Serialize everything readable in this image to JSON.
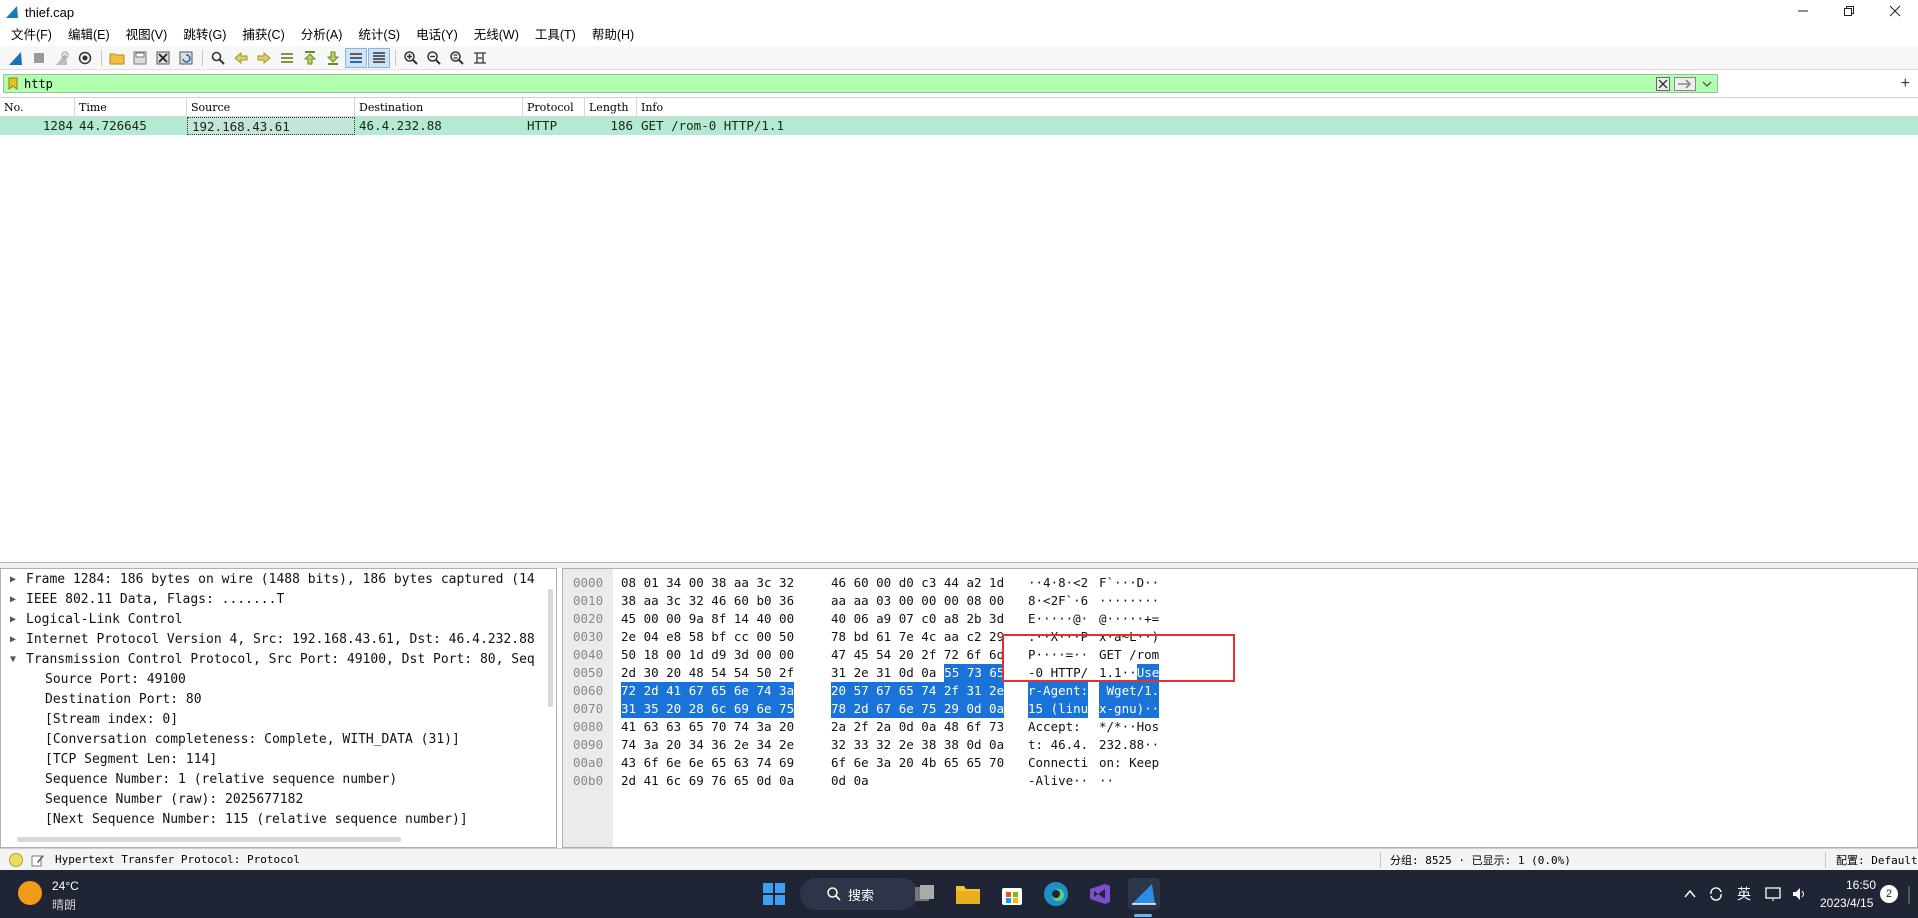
{
  "window": {
    "title": "thief.cap"
  },
  "menu": [
    "文件(F)",
    "编辑(E)",
    "视图(V)",
    "跳转(G)",
    "捕获(C)",
    "分析(A)",
    "统计(S)",
    "电话(Y)",
    "无线(W)",
    "工具(T)",
    "帮助(H)"
  ],
  "toolbar_icons": [
    "shark-fin-start-icon",
    "stop-icon",
    "restart-icon",
    "options-gear-icon",
    "open-folder-icon",
    "save-file-icon",
    "close-file-icon",
    "reload-icon",
    "find-icon",
    "back-icon",
    "forward-icon",
    "goto-packet-icon",
    "first-packet-icon",
    "last-packet-icon",
    "autoscroll-icon",
    "colorize-icon",
    "zoom-in-icon",
    "zoom-out-icon",
    "normal-size-icon",
    "resize-columns-icon"
  ],
  "filter": {
    "value": "http"
  },
  "packet_list": {
    "columns": [
      "No.",
      "Time",
      "Source",
      "Destination",
      "Protocol",
      "Length",
      "Info"
    ],
    "rows": [
      {
        "no": "1284",
        "time": "44.726645",
        "source": "192.168.43.61",
        "destination": "46.4.232.88",
        "protocol": "HTTP",
        "length": "186",
        "info": "GET /rom-0 HTTP/1.1"
      }
    ]
  },
  "details": {
    "top": [
      {
        "chev": ">",
        "text": "Frame 1284: 186 bytes on wire (1488 bits), 186 bytes captured (14"
      },
      {
        "chev": ">",
        "text": "IEEE 802.11 Data, Flags: .......T"
      },
      {
        "chev": ">",
        "text": "Logical-Link Control"
      },
      {
        "chev": ">",
        "text": "Internet Protocol Version 4, Src: 192.168.43.61, Dst: 46.4.232.88"
      },
      {
        "chev": "v",
        "text": "Transmission Control Protocol, Src Port: 49100, Dst Port: 80, Seq"
      }
    ],
    "children": [
      "Source Port: 49100",
      "Destination Port: 80",
      "[Stream index: 0]",
      "[Conversation completeness: Complete, WITH_DATA (31)]",
      "[TCP Segment Len: 114]",
      "Sequence Number: 1    (relative sequence number)",
      "Sequence Number (raw): 2025677182",
      "[Next Sequence Number: 115    (relative sequence number)]"
    ]
  },
  "hex": {
    "rows": [
      {
        "off": "0000",
        "h1": "08 01 34 00 38 aa 3c 32",
        "h2": "46 60 00 d0 c3 44 a2 1d",
        "a1": "··4·8·<2",
        "a2": "F`···D··"
      },
      {
        "off": "0010",
        "h1": "38 aa 3c 32 46 60 b0 36",
        "h2": "aa aa 03 00 00 00 08 00",
        "a1": "8·<2F`·6",
        "a2": "········"
      },
      {
        "off": "0020",
        "h1": "45 00 00 9a 8f 14 40 00",
        "h2": "40 06 a9 07 c0 a8 2b 3d",
        "a1": "E·····@·",
        "a2": "@·····+="
      },
      {
        "off": "0030",
        "h1": "2e 04 e8 58 bf cc 00 50",
        "h2": "78 bd 61 7e 4c aa c2 29",
        "a1": ".··X···P",
        "a2": "x·a~L··)"
      },
      {
        "off": "0040",
        "h1": "50 18 00 1d d9 3d 00 00",
        "h2": "47 45 54 20 2f 72 6f 6d",
        "a1": "P····=··",
        "a2": "GET /rom"
      },
      {
        "off": "0050",
        "h1": "2d 30 20 48 54 54 50 2f",
        "h2a": "31 2e 31 0d 0a ",
        "h2b": "55 73 65",
        "a1": "-0 HTTP/",
        "a2a": "1.1··",
        "a2b": "Use"
      },
      {
        "off": "0060",
        "h1": "72 2d 41 67 65 6e 74 3a",
        "h2": "20 57 67 65 74 2f 31 2e",
        "a1": "r-Agent:",
        "a2": " Wget/1.",
        "hl": true
      },
      {
        "off": "0070",
        "h1": "31 35 20 28 6c 69 6e 75",
        "h2": "78 2d 67 6e 75 29 0d 0a",
        "a1": "15 (linu",
        "a2": "x-gnu)··",
        "hl": true
      },
      {
        "off": "0080",
        "h1": "41 63 63 65 70 74 3a 20",
        "h2": "2a 2f 2a 0d 0a 48 6f 73",
        "a1": "Accept: ",
        "a2": "*/*··Hos"
      },
      {
        "off": "0090",
        "h1": "74 3a 20 34 36 2e 34 2e",
        "h2": "32 33 32 2e 38 38 0d 0a",
        "a1": "t: 46.4.",
        "a2": "232.88··"
      },
      {
        "off": "00a0",
        "h1": "43 6f 6e 6e 65 63 74 69",
        "h2": "6f 6e 3a 20 4b 65 65 70",
        "a1": "Connecti",
        "a2": "on: Keep"
      },
      {
        "off": "00b0",
        "h1": "2d 41 6c 69 76 65 0d 0a",
        "h2": "0d 0a",
        "a1": "-Alive··",
        "a2": "··"
      }
    ]
  },
  "status": {
    "field": "Hypertext Transfer Protocol: Protocol",
    "packets": "分组: 8525 · 已显示: 1 (0.0%)",
    "profile": "配置: Default"
  },
  "taskbar": {
    "weather_temp": "24°C",
    "weather_desc": "晴朗",
    "search": "搜索",
    "ime": "英",
    "time": "16:50",
    "date": "2023/4/15",
    "notif_count": "2"
  },
  "colors": {
    "filter_ok": "#afffaf",
    "row_http": "#b2ebd1",
    "hex_highlight": "#1a73d8",
    "annotation": "#e53030"
  }
}
